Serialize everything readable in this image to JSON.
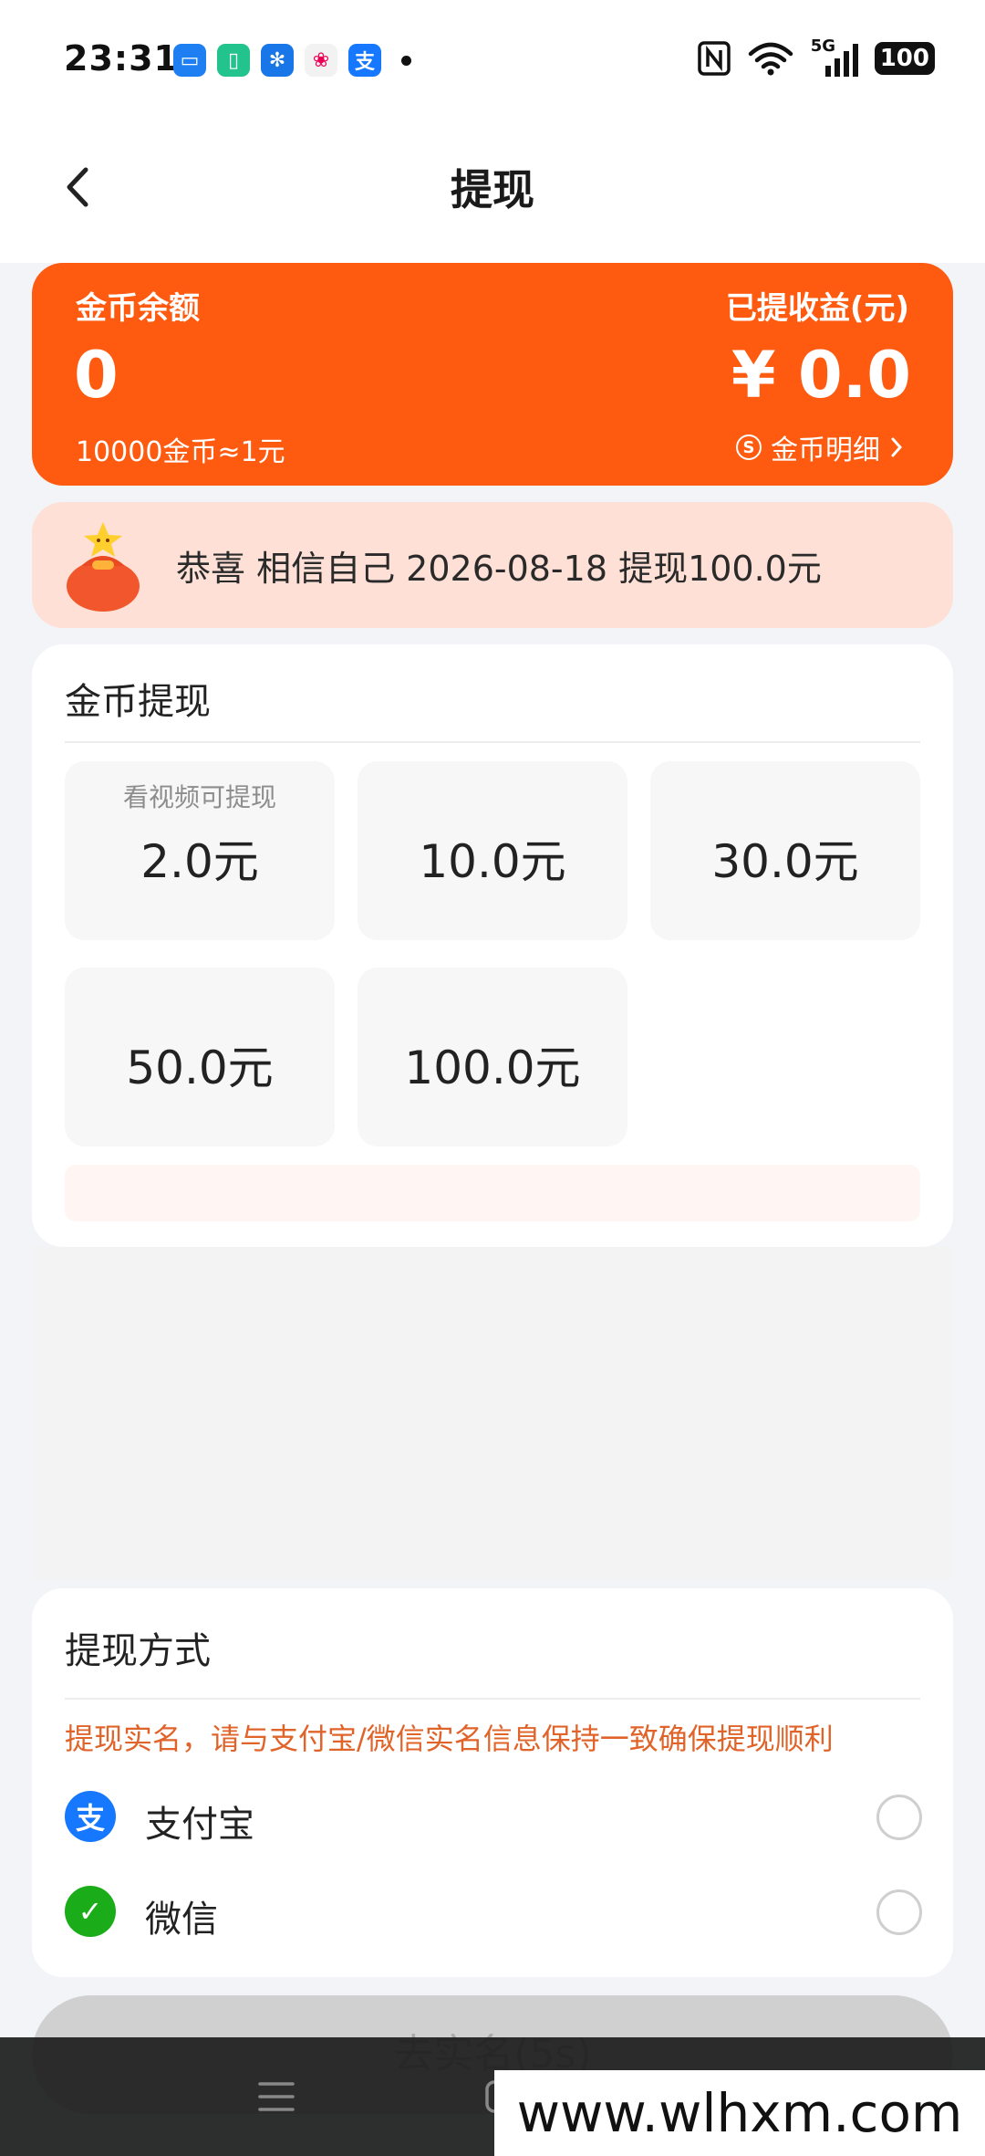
{
  "status_bar": {
    "time": "23:31",
    "battery": "100",
    "network": "5G",
    "app_icons": [
      "message-app-icon",
      "phone-clone-icon",
      "pinwheel-app-icon",
      "photos-app-icon",
      "alipay-app-icon"
    ],
    "right_icons": [
      "nfc-icon",
      "wifi-icon",
      "signal-icon",
      "battery-icon"
    ]
  },
  "header": {
    "title": "提现",
    "back_icon": "chevron-left-icon"
  },
  "balance": {
    "coin_label": "金币余额",
    "coin_value": "0",
    "withdrawn_label": "已提收益(元)",
    "withdrawn_value": "¥ 0.0",
    "rate_text": "10000金币≈1元",
    "detail_link": "金币明细",
    "detail_symbol": "S"
  },
  "announcement": {
    "text": "恭喜 相信自己 2026-08-18 提现100.0元",
    "icon": "lucky-bag-icon"
  },
  "withdraw": {
    "title": "金币提现",
    "options": [
      {
        "label": "2.0元",
        "hint": "看视频可提现"
      },
      {
        "label": "10.0元"
      },
      {
        "label": "30.0元"
      },
      {
        "label": "50.0元"
      },
      {
        "label": "100.0元"
      }
    ]
  },
  "methods": {
    "title": "提现方式",
    "warning": "提现实名，请与支付宝/微信实名信息保持一致确保提现顺利",
    "items": [
      {
        "label": "支付宝",
        "icon": "alipay-icon",
        "color": "#1677ff",
        "glyph": "支"
      },
      {
        "label": "微信",
        "icon": "wechat-icon",
        "color": "#1aad19",
        "glyph": "✓"
      }
    ]
  },
  "submit": {
    "label": "去实名(5s)"
  },
  "watermark": {
    "text": "www.wlhxm.com"
  },
  "colors": {
    "accent": "#fe5a10",
    "announce_bg": "#fee0d6",
    "warning": "#e0642a"
  }
}
